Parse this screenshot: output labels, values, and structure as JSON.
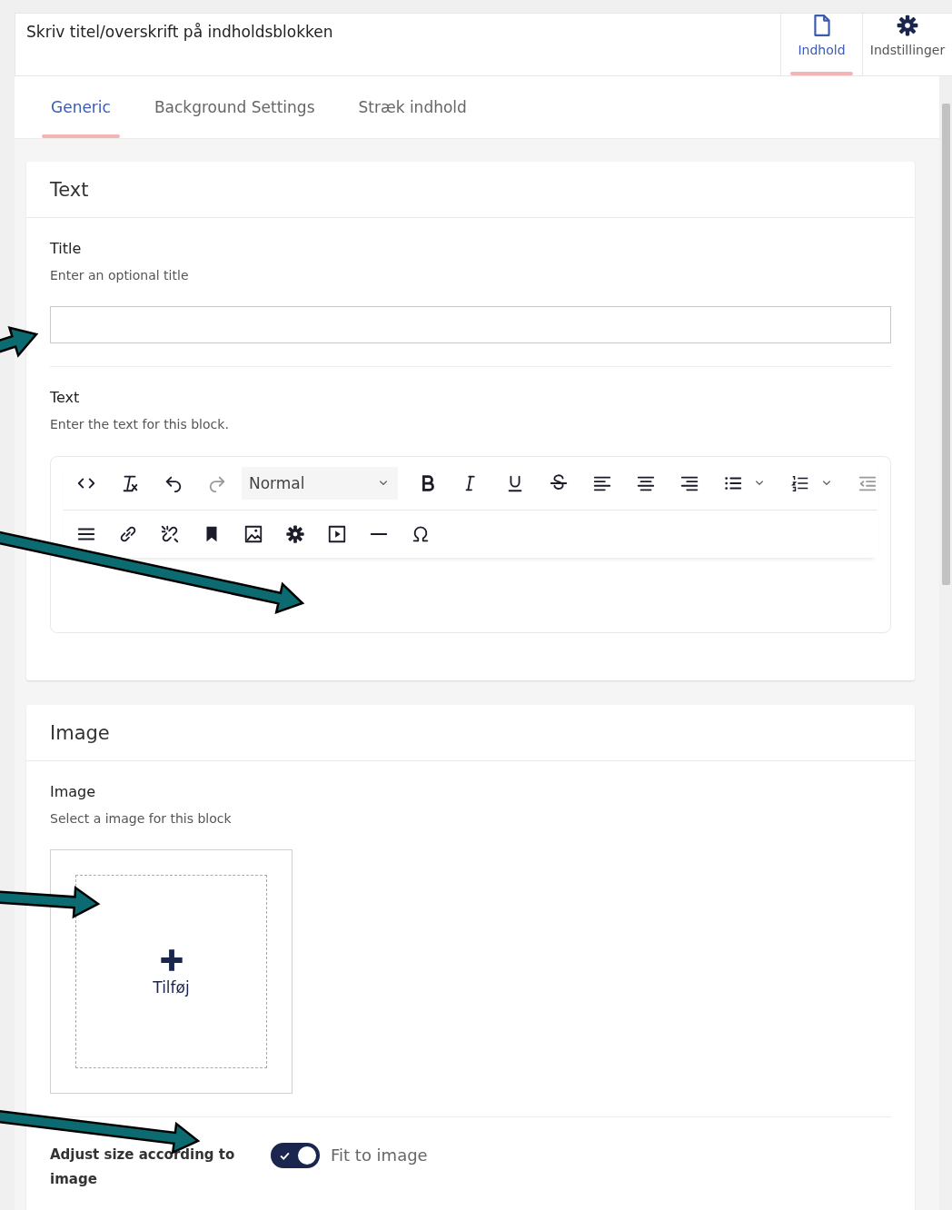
{
  "header": {
    "title": "Skriv titel/overskrift på indholdsblokken",
    "views": [
      {
        "kind": "document",
        "label": "Indhold",
        "selected": true
      },
      {
        "kind": "gear",
        "label": "Indstillinger",
        "selected": false
      }
    ]
  },
  "tabs": [
    {
      "label": "Generic",
      "selected": true
    },
    {
      "label": "Background Settings",
      "selected": false
    },
    {
      "label": "Stræk indhold",
      "selected": false
    }
  ],
  "text_section": {
    "heading": "Text",
    "title_field": {
      "label": "Title",
      "description": "Enter an optional title"
    },
    "text_field": {
      "label": "Text",
      "description": "Enter the text for this block.",
      "format": "Normal",
      "toolbar": [
        [
          {
            "kind": "code",
            "disabled": false
          },
          {
            "kind": "clear-format",
            "disabled": false
          },
          {
            "kind": "undo",
            "disabled": false
          },
          {
            "kind": "redo",
            "disabled": true
          },
          {
            "kind": "format-select",
            "disabled": false
          },
          {
            "kind": "bold",
            "disabled": false
          },
          {
            "kind": "italic",
            "disabled": false
          },
          {
            "kind": "underline",
            "disabled": false
          },
          {
            "kind": "strike",
            "disabled": false
          },
          {
            "kind": "align-left",
            "disabled": false
          },
          {
            "kind": "align-center",
            "disabled": false
          },
          {
            "kind": "align-right",
            "disabled": false
          },
          {
            "kind": "bullet-list",
            "disabled": false
          },
          {
            "kind": "caret",
            "disabled": false
          },
          {
            "kind": "number-list",
            "disabled": false
          },
          {
            "kind": "caret",
            "disabled": false
          },
          {
            "kind": "outdent",
            "disabled": true
          }
        ],
        [
          {
            "kind": "justify",
            "disabled": false
          },
          {
            "kind": "link",
            "disabled": false
          },
          {
            "kind": "unlink",
            "disabled": false
          },
          {
            "kind": "bookmark",
            "disabled": false
          },
          {
            "kind": "image",
            "disabled": false
          },
          {
            "kind": "gear",
            "disabled": false
          },
          {
            "kind": "media",
            "disabled": false
          },
          {
            "kind": "rule",
            "disabled": false
          },
          {
            "kind": "omega",
            "disabled": false
          }
        ]
      ]
    }
  },
  "image_section": {
    "heading": "Image",
    "image_field": {
      "label": "Image",
      "description": "Select a image for this block",
      "add_label": "Tilføj"
    },
    "adjust": {
      "label": "Adjust size according to image",
      "on": true,
      "option": "Fit to image"
    }
  }
}
